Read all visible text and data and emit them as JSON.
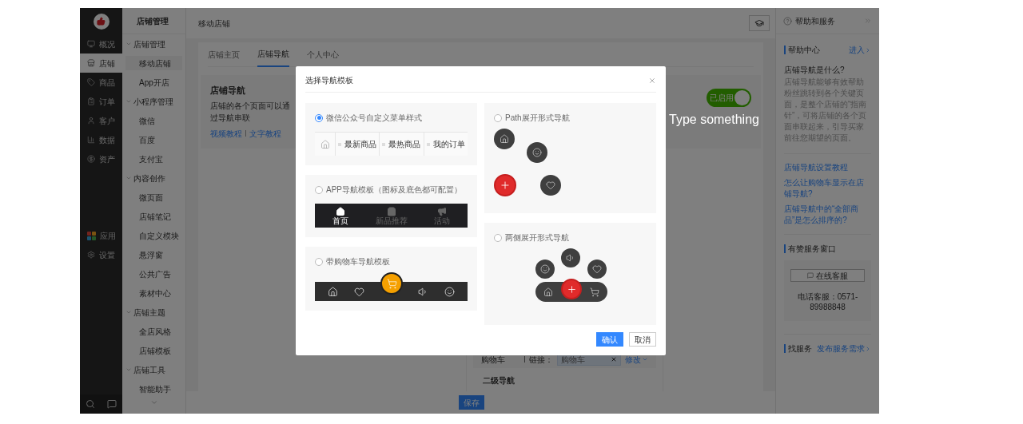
{
  "nav": {
    "main_items": [
      {
        "label": "概况",
        "selected": false
      },
      {
        "label": "店铺",
        "selected": true
      },
      {
        "label": "商品",
        "selected": false
      },
      {
        "label": "订单",
        "selected": false
      },
      {
        "label": "客户",
        "selected": false
      },
      {
        "label": "数据",
        "selected": false
      },
      {
        "label": "资产",
        "selected": false
      }
    ],
    "extra_items": [
      {
        "label": "应用",
        "selected": false
      },
      {
        "label": "设置",
        "selected": false
      }
    ]
  },
  "subnav": {
    "title": "店铺管理",
    "groups": [
      {
        "label": "店铺管理",
        "expanded": true,
        "children": [
          {
            "label": "移动店铺",
            "selected": true
          },
          {
            "label": "App开店",
            "selected": false
          }
        ]
      },
      {
        "label": "小程序管理",
        "expanded": true,
        "children": [
          {
            "label": "微信",
            "selected": false
          },
          {
            "label": "百度",
            "selected": false
          },
          {
            "label": "支付宝",
            "selected": false
          }
        ]
      },
      {
        "label": "内容创作",
        "expanded": true,
        "children": [
          {
            "label": "微页面",
            "selected": false
          },
          {
            "label": "店铺笔记",
            "selected": false
          },
          {
            "label": "自定义模块",
            "selected": false
          },
          {
            "label": "悬浮窗",
            "selected": false
          },
          {
            "label": "公共广告",
            "selected": false
          },
          {
            "label": "素材中心",
            "selected": false
          }
        ]
      },
      {
        "label": "店铺主题",
        "expanded": true,
        "children": [
          {
            "label": "全店风格",
            "selected": false
          },
          {
            "label": "店铺模板",
            "selected": false
          }
        ]
      },
      {
        "label": "店铺工具",
        "expanded": true,
        "children": [
          {
            "label": "智能助手",
            "selected": false
          }
        ]
      }
    ]
  },
  "page": {
    "title": "移动店铺",
    "tabs": [
      {
        "label": "店铺主页",
        "selected": false
      },
      {
        "label": "店铺导航",
        "selected": true
      },
      {
        "label": "个人中心",
        "selected": false
      }
    ],
    "section": {
      "title": "店铺导航",
      "description": "店铺的各个页面可以通过导航串联",
      "links": [
        "视频教程",
        "文字教程"
      ],
      "toggle": {
        "label": "已启用",
        "on": true
      }
    },
    "nav_row": {
      "name": "购物车",
      "link_label": "链接：",
      "link_value": "购物车",
      "action": "修改"
    },
    "second_level_title": "二级导航",
    "save_button": "保存"
  },
  "modal": {
    "title": "选择导航模板",
    "columns": [
      {
        "templates": [
          {
            "kind": "wechat_menu",
            "label": "微信公众号自定义菜单样式",
            "selected": true,
            "menu_items": [
              "最新商品",
              "最热商品",
              "我的订单"
            ]
          },
          {
            "kind": "app",
            "label": "APP导航模板（图标及底色都可配置）",
            "selected": false,
            "tab_labels": [
              "首页",
              "新品推荐",
              "活动"
            ]
          },
          {
            "kind": "cart",
            "label": "带购物车导航模板",
            "selected": false
          }
        ]
      },
      {
        "templates": [
          {
            "kind": "path",
            "label": "Path展开形式导航",
            "selected": false
          },
          {
            "kind": "sides",
            "label": "两侧展开形式导航",
            "selected": false
          }
        ]
      }
    ],
    "confirm": "确认",
    "cancel": "取消"
  },
  "help": {
    "title": "帮助和服务",
    "center": {
      "title": "帮助中心",
      "enter": "进入",
      "question": "店铺导航是什么?",
      "answer": "店铺导航能够有效帮助粉丝跳转到各个关键页面，是整个店铺的“指南针”，可将店铺的各个页面串联起来，引导买家前往您期望的页面。",
      "links": [
        "店铺导航设置教程",
        "怎么让购物车显示在店铺导航?",
        "店铺导航中的“全部商品”是怎么排序的?"
      ]
    },
    "service": {
      "title": "有赞服务窗口",
      "button": "在线客服",
      "phone": "电话客服：0571-89988848"
    },
    "find": {
      "title": "找服务",
      "action": "发布服务需求"
    }
  },
  "overlay_text": "Type something"
}
